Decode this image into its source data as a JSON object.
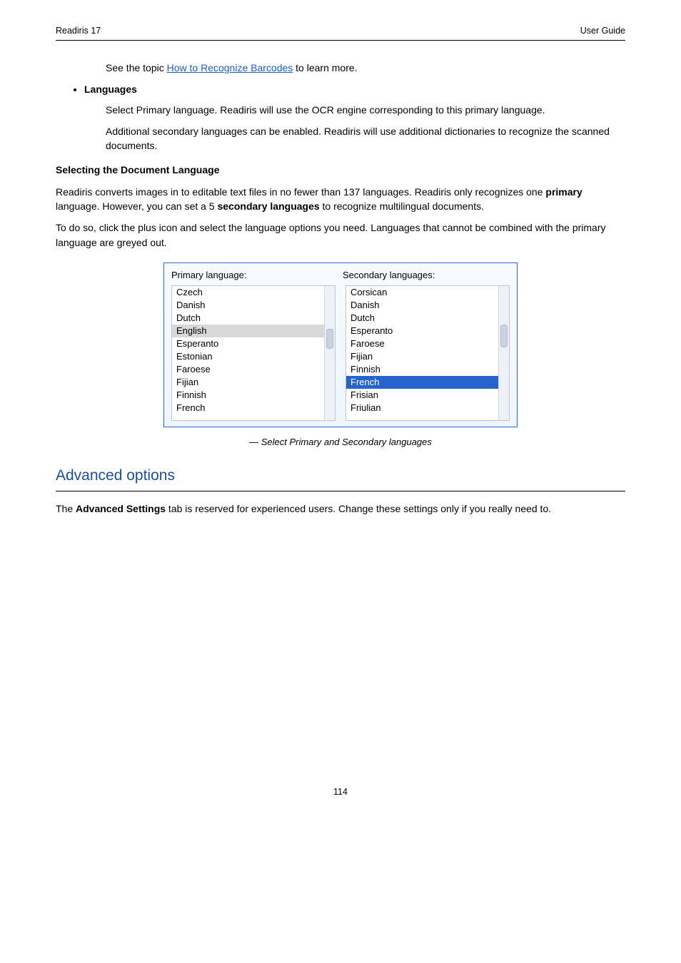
{
  "header": {
    "left": "Readiris 17",
    "right": "User Guide"
  },
  "body": {
    "para1_before_link": "See the topic ",
    "para1_link": "How to Recognize Barcodes",
    "para1_after_link": " to learn more.",
    "bullet1": "Languages",
    "indent1": "Select Primary language. Readiris will use the OCR engine corresponding to this primary language.",
    "indent2": "Additional secondary languages can be enabled. Readiris will use additional dictionaries to recognize the scanned documents.",
    "subhead": "Selecting the Document Language",
    "para2_a": "Readiris converts images in to editable text files in no fewer than 137 languages. Readiris only recognizes one ",
    "para2_b": "primary",
    "para2_c": " language. However, you can set a 5 ",
    "para2_d": "secondary languages",
    "para2_e": " to recognize multilingual documents.",
    "para3": "To do so, click the plus icon and select the language options you need. Languages that cannot be combined with the primary language are greyed out."
  },
  "figure": {
    "primary_label": "Primary language:",
    "secondary_label": "Secondary languages:",
    "primary_items": [
      "Czech",
      "Danish",
      "Dutch",
      "English",
      "Esperanto",
      "Estonian",
      "Faroese",
      "Fijian",
      "Finnish",
      "French"
    ],
    "primary_selected_index": 3,
    "secondary_items": [
      "Corsican",
      "Danish",
      "Dutch",
      "Esperanto",
      "Faroese",
      "Fijian",
      "Finnish",
      "French",
      "Frisian",
      "Friulian"
    ],
    "secondary_selected_index": 7,
    "caption": "Select Primary and Secondary languages"
  },
  "section": {
    "title": "Advanced options",
    "para_a": "The ",
    "para_b": "Advanced Settings",
    "para_c": " tab is reserved for experienced users. Change these settings only if you really need to."
  },
  "footer": {
    "page": "114"
  }
}
